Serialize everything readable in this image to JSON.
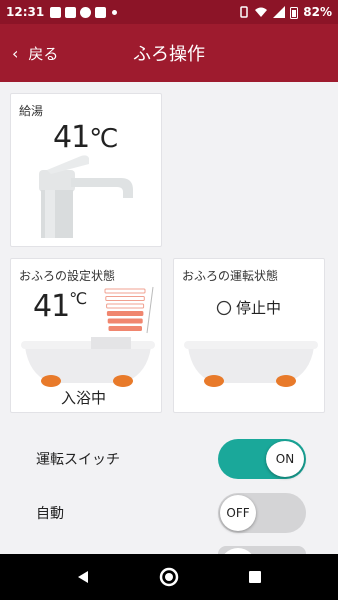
{
  "status_bar": {
    "time": "12:31",
    "battery": "82%"
  },
  "header": {
    "back_label": "戻る",
    "title": "ふろ操作"
  },
  "hot_water": {
    "label": "給湯",
    "temp": "41",
    "unit": "℃"
  },
  "bath_setting": {
    "label": "おふろの設定状態",
    "temp": "41",
    "unit": "℃",
    "state": "入浴中",
    "level_bars_lit": 3,
    "level_bars_total": 6
  },
  "bath_operation": {
    "label": "おふろの運転状態",
    "state": "停止中"
  },
  "toggles": [
    {
      "label": "運転スイッチ",
      "value": "ON",
      "on": true
    },
    {
      "label": "自動",
      "value": "OFF",
      "on": false
    }
  ],
  "colors": {
    "brand": "#9e1b2e",
    "toggle_on": "#1aa89a",
    "toggle_off": "#d4d4d6",
    "feet": "#e87a2a"
  },
  "icons": [
    "back-chevron-icon",
    "faucet-icon",
    "bathtub-icon",
    "nav-back-icon",
    "nav-home-icon",
    "nav-recents-icon"
  ]
}
